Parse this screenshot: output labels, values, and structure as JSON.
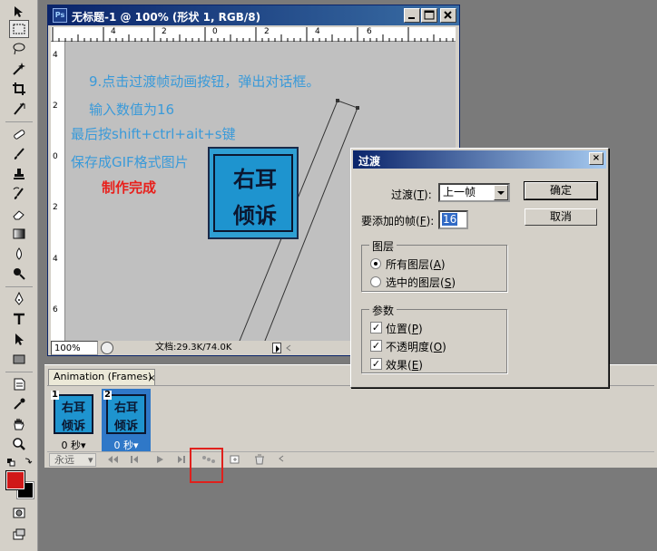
{
  "document": {
    "title": "无标题-1 @ 100% (形状 1, RGB/8)",
    "ps_badge": "Ps",
    "ruler_top": [
      "4",
      "2",
      "0",
      "2",
      "4",
      "6"
    ],
    "ruler_left": [
      "4",
      "2",
      "0",
      "2",
      "4",
      "6"
    ],
    "canvas_lines": [
      {
        "text": "9.点击过渡帧动画按钮，弹出对话框。",
        "color": "#3a9ad9"
      },
      {
        "text": "输入数值为16",
        "color": "#3a9ad9"
      },
      {
        "text": "最后按shift+ctrl+ait+s键",
        "color": "#3a9ad9"
      },
      {
        "text": "保存成GIF格式图片",
        "color": "#3a9ad9"
      },
      {
        "text": "制作完成",
        "color": "#e8201c"
      }
    ],
    "logo_line1": "右耳",
    "logo_line2": "倾诉",
    "zoom": "100%",
    "doc_size": "文档:29.3K/74.0K"
  },
  "animation": {
    "tab_label": "Animation (Frames)",
    "tab_close": "×",
    "frames": [
      {
        "num": "1",
        "delay": "0 秒▾",
        "selected": false
      },
      {
        "num": "2",
        "delay": "0 秒▾",
        "selected": true
      }
    ],
    "loop": "永远",
    "loop_arrow": "▾"
  },
  "dialog": {
    "title": "过渡",
    "close": "×",
    "tween_with_label": "过渡(",
    "tween_with_key": "T",
    "tween_with_value": "上一帧",
    "frames_to_add_label": "要添加的帧(",
    "frames_to_add_key": "F",
    "frames_to_add_value": "16",
    "ok_label": "确定",
    "cancel_label": "取消",
    "layers_group": "图层",
    "all_layers": "所有图层(",
    "all_layers_key": "A",
    "selected_layers": "选中的图层(",
    "selected_layers_key": "S",
    "params_group": "参数",
    "position": "位置(",
    "position_key": "P",
    "opacity": "不透明度(",
    "opacity_key": "O",
    "effects": "效果(",
    "effects_key": "E",
    "paren_close": ")",
    "paren_colon": "):",
    "check_mark": "✓"
  },
  "colors": {
    "foreground": "#d01818",
    "background": "#000000",
    "title_blue": "#0a246a",
    "highlight": "#e0201c"
  }
}
